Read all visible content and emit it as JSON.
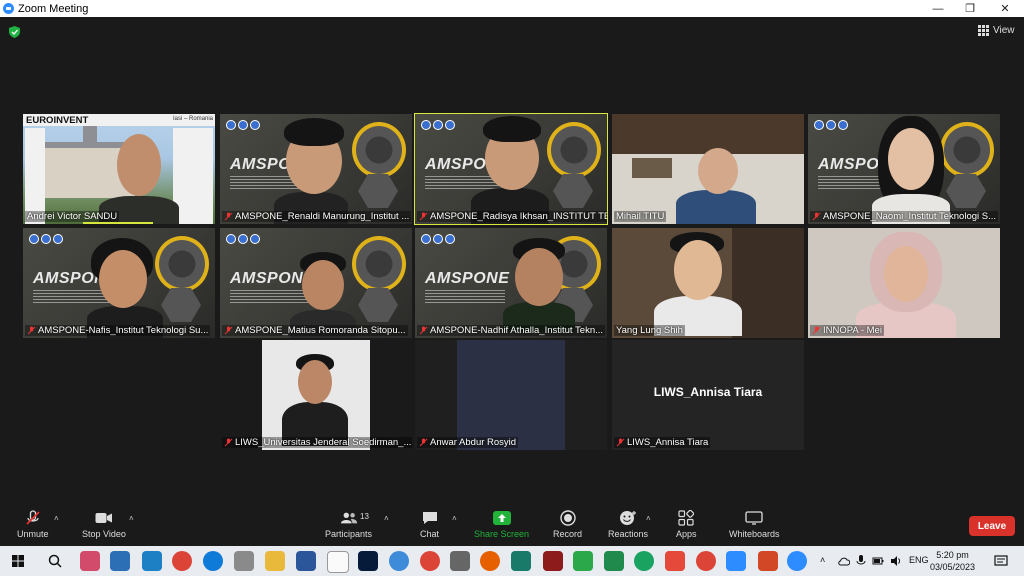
{
  "window": {
    "title": "Zoom Meeting"
  },
  "view": {
    "label": "View"
  },
  "tiles": [
    {
      "name": "Andrei Victor SANDU",
      "overlay_title": "EUROINVENT",
      "overlay_sub": "Iasi – Romania"
    },
    {
      "name": "AMSPONE_Renaldi Manurung_Institut ...",
      "slide": "AMSPONE"
    },
    {
      "name": "AMSPONE_Radisya Ikhsan_INSTITUT TEK...",
      "slide": "AMSPONE"
    },
    {
      "name": "Mihail TITU"
    },
    {
      "name": "AMSPONE_Naomi_Institut Teknologi S...",
      "slide": "AMSPONE"
    },
    {
      "name": "AMSPONE-Nafis_Institut Teknologi Su...",
      "slide": "AMSPONE"
    },
    {
      "name": "AMSPONE_Matius Romoranda Sitopu...",
      "slide": "AMSPONE"
    },
    {
      "name": "AMSPONE-Nadhif Athalla_Institut Tekn...",
      "slide": "AMSPONE"
    },
    {
      "name": "Yang Lung Shih"
    },
    {
      "name": "INNOPA - Mei"
    },
    {
      "name": "LIWS_Universitas Jenderal Soedirman_..."
    },
    {
      "name": "Anwar Abdur Rosyid"
    },
    {
      "name": "LIWS_Annisa Tiara",
      "center": "LIWS_Annisa Tiara"
    }
  ],
  "toolbar": {
    "unmute": "Unmute",
    "stop_video": "Stop Video",
    "participants": "Participants",
    "participants_count": "13",
    "chat": "Chat",
    "share_screen": "Share Screen",
    "record": "Record",
    "reactions": "Reactions",
    "apps": "Apps",
    "whiteboards": "Whiteboards",
    "leave": "Leave"
  },
  "taskbar": {
    "lang": "ENG",
    "time": "5:20 pm",
    "date": "03/05/2023"
  },
  "colors": {
    "active_speaker": "#d6e73d",
    "leave": "#d9322b",
    "share": "#22b33a",
    "zoom_blue": "#2d8cff"
  }
}
